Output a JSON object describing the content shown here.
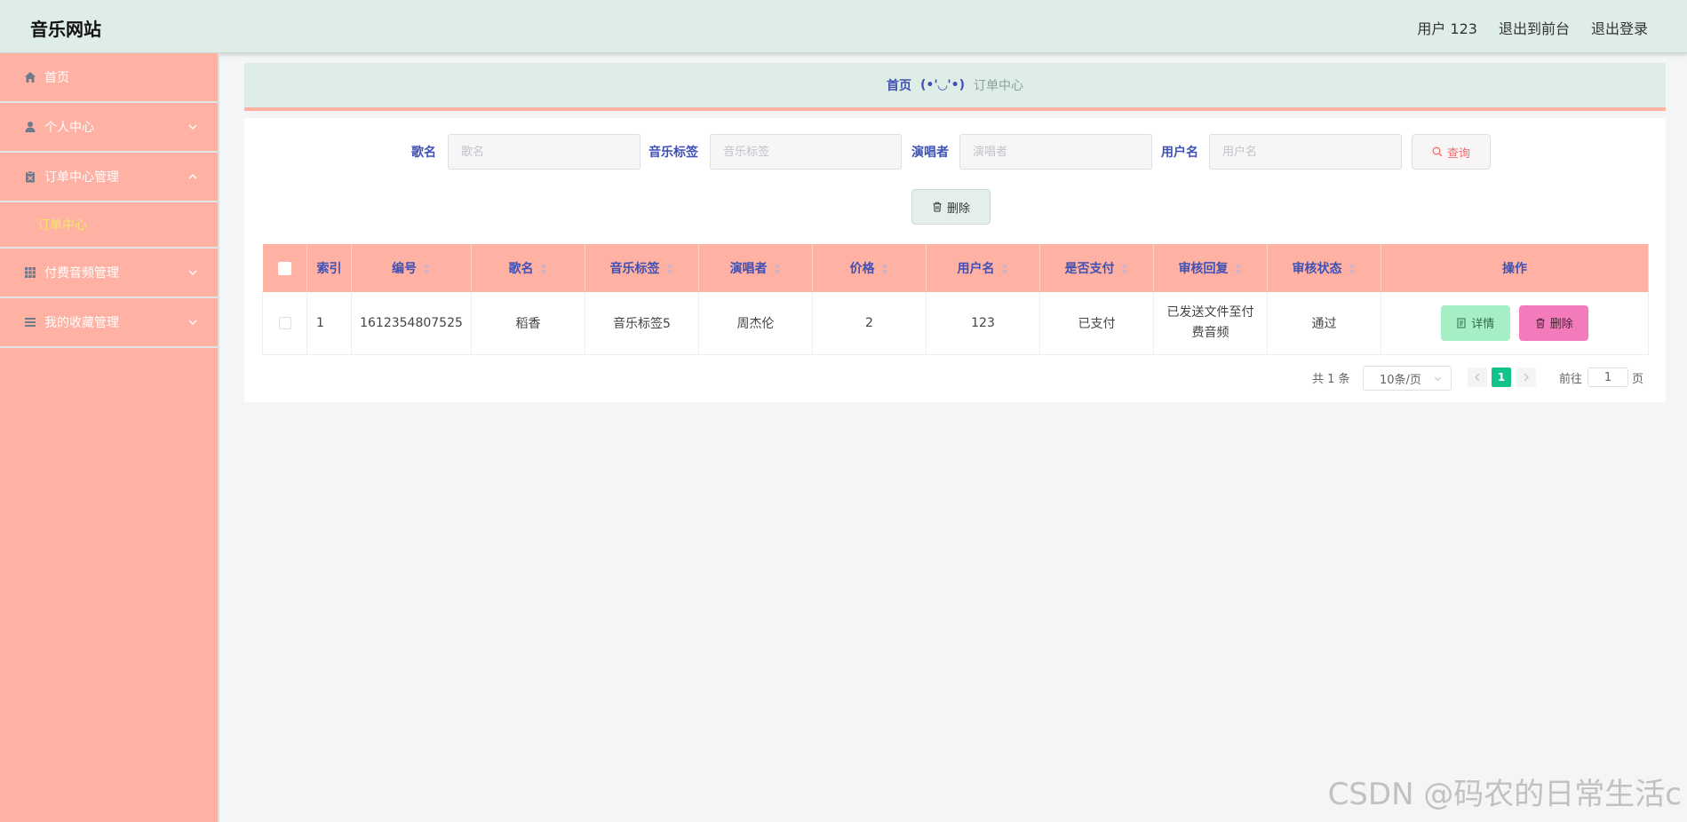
{
  "header": {
    "title": "音乐网站",
    "user": "用户 123",
    "back_front": "退出到前台",
    "logout": "退出登录"
  },
  "sidebar": {
    "items": [
      {
        "label": "首页",
        "icon": "home-icon"
      },
      {
        "label": "个人中心",
        "icon": "user-icon",
        "expand": "down"
      },
      {
        "label": "订单中心管理",
        "icon": "clipboard-icon",
        "expand": "up"
      },
      {
        "label": "付费音频管理",
        "icon": "grid-icon",
        "expand": "down"
      },
      {
        "label": "我的收藏管理",
        "icon": "list-icon",
        "expand": "down"
      }
    ],
    "submenu": {
      "label": "订单中心"
    }
  },
  "breadcrumb": {
    "home": "首页",
    "separator": "(•'◡'•)",
    "current": "订单中心"
  },
  "search": {
    "song_label": "歌名",
    "song_placeholder": "歌名",
    "tag_label": "音乐标签",
    "tag_placeholder": "音乐标签",
    "singer_label": "演唱者",
    "singer_placeholder": "演唱者",
    "user_label": "用户名",
    "user_placeholder": "用户名",
    "query_button": "查询"
  },
  "toolbar": {
    "delete_button": "删除"
  },
  "table": {
    "columns": [
      "索引",
      "编号",
      "歌名",
      "音乐标签",
      "演唱者",
      "价格",
      "用户名",
      "是否支付",
      "审核回复",
      "审核状态",
      "操作"
    ],
    "rows": [
      {
        "index": "1",
        "number": "1612354807525",
        "song": "稻香",
        "tag": "音乐标签5",
        "singer": "周杰伦",
        "price": "2",
        "username": "123",
        "paid": "已支付",
        "reply": "已发送文件至付费音频",
        "status": "通过",
        "detail_button": "详情",
        "delete_button": "删除"
      }
    ]
  },
  "pagination": {
    "total": "共 1 条",
    "page_size": "10条/页",
    "current_page": "1",
    "goto_label": "前往",
    "goto_value": "1",
    "page_suffix": "页"
  },
  "watermark": "CSDN @码农的日常生活c",
  "colors": {
    "header_bg": "#deede6",
    "sidebar_bg": "#ffb1a3",
    "accent_blue": "#3f51b5",
    "active_page": "#13c18a",
    "detail_btn": "#a6efc4",
    "delete_btn": "#f47bbb",
    "submenu_active": "#f5e86a"
  }
}
